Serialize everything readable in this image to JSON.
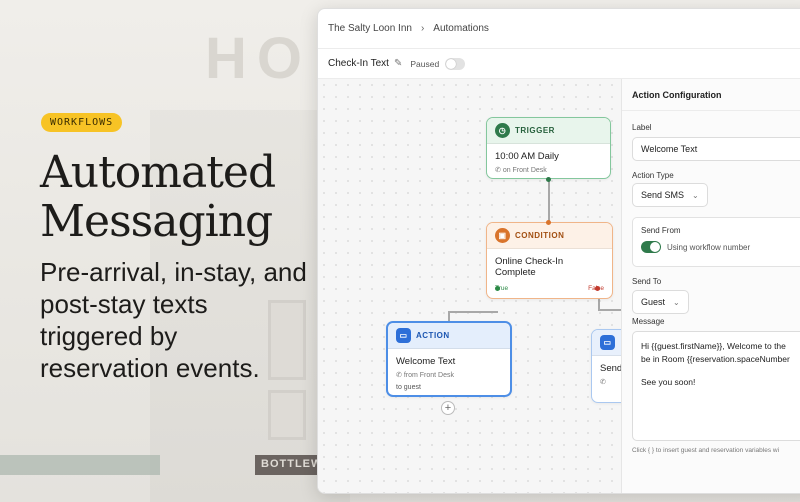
{
  "hero": {
    "badge": "WORKFLOWS",
    "title_line1": "Automated",
    "title_line2": "Messaging",
    "subtitle": "Pre-arrival, in-stay, and post-stay texts triggered by reservation events."
  },
  "background": {
    "sign": "HO",
    "store_sign": "BOTTLEW"
  },
  "app": {
    "breadcrumb": {
      "property": "The Salty Loon Inn",
      "separator": "›",
      "section": "Automations"
    },
    "workflow": {
      "name": "Check-In Text",
      "status_label": "Paused",
      "paused_toggle_on": false
    },
    "nodes": {
      "trigger": {
        "type_label": "TRIGGER",
        "title": "10:00 AM Daily",
        "meta": "on Front Desk"
      },
      "condition": {
        "type_label": "CONDITION",
        "title": "Online Check-In Complete",
        "true_label": "True",
        "false_label": "False"
      },
      "action": {
        "type_label": "ACTION",
        "title": "Welcome Text",
        "meta": "from Front Desk",
        "recipient": "to guest"
      },
      "action2": {
        "title": "Send"
      }
    },
    "panel": {
      "heading": "Action Configuration",
      "label_label": "Label",
      "label_value": "Welcome Text",
      "action_type_label": "Action Type",
      "action_type_value": "Send SMS",
      "send_from_label": "Send From",
      "send_from_value": "Using workflow number",
      "send_to_label": "Send To",
      "send_to_value": "Guest",
      "message_label": "Message",
      "message_line1": "Hi {{guest.firstName}}, Welcome to the",
      "message_line2": "be in Room {{reservation.spaceNumber",
      "message_line3": "See you soon!",
      "hint": "Click {  } to insert guest and reservation variables wi"
    },
    "colors": {
      "trigger": "#2f7a4b",
      "condition": "#d9742c",
      "action": "#2d6fd8",
      "badge": "#f7c325"
    }
  }
}
